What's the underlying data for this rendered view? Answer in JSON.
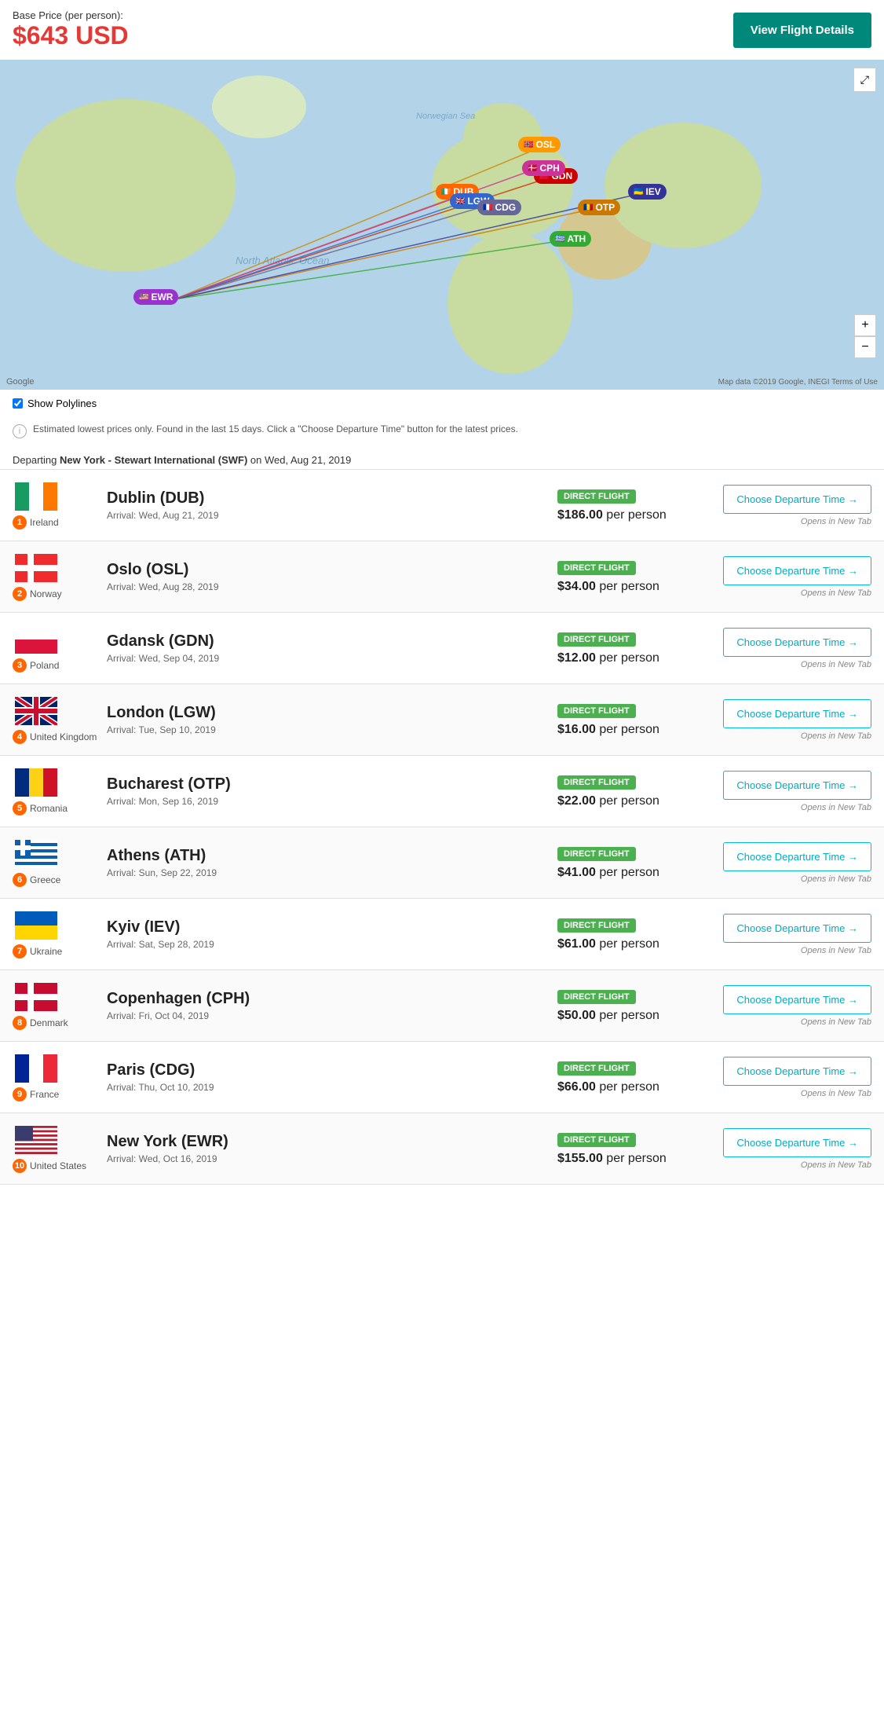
{
  "header": {
    "price_label": "Base Price (per person):",
    "price_value": "$643 USD",
    "view_details_label": "View Flight Details"
  },
  "map": {
    "expand_icon": "⤢",
    "zoom_in": "+",
    "zoom_out": "−",
    "google_label": "Google",
    "terms_label": "Map data ©2019 Google, INEGI  Terms of Use",
    "show_polylines_label": "Show Polylines"
  },
  "notice": {
    "text": "Estimated lowest prices only. Found in the last 15 days. Click a \"Choose Departure Time\" button for the latest prices."
  },
  "departing": {
    "label": "Departing New York - Stewart International (SWF) on Wed, Aug 21, 2019"
  },
  "flights": [
    {
      "num": 1,
      "country": "Ireland",
      "flag_colors": [
        "#169b62",
        "#fff",
        "#ff7900"
      ],
      "flag_type": "tricolor_vertical",
      "destination": "Dublin (DUB)",
      "arrival": "Arrival: Wed, Aug 21, 2019",
      "badge": "DIRECT FLIGHT",
      "price": "$186.00 per person",
      "price_amount": "$186.00",
      "btn_label": "Choose Departure Time →",
      "opens_label": "Opens in New Tab",
      "pin_code": "DUB",
      "pin_color": "#ff6600"
    },
    {
      "num": 2,
      "country": "Norway",
      "flag_colors": [
        "#ef2b2d",
        "#fff",
        "#002868"
      ],
      "flag_type": "cross",
      "destination": "Oslo (OSL)",
      "arrival": "Arrival: Wed, Aug 28, 2019",
      "badge": "DIRECT FLIGHT",
      "price": "$34.00 per person",
      "price_amount": "$34.00",
      "btn_label": "Choose Departure Time →",
      "opens_label": "Opens in New Tab",
      "pin_code": "OSL",
      "pin_color": "#ff9900"
    },
    {
      "num": 3,
      "country": "Poland",
      "flag_colors": [
        "#fff",
        "#dc143c"
      ],
      "flag_type": "bicolor_horizontal",
      "destination": "Gdansk (GDN)",
      "arrival": "Arrival: Wed, Sep 04, 2019",
      "badge": "DIRECT FLIGHT",
      "price": "$12.00 per person",
      "price_amount": "$12.00",
      "btn_label": "Choose Departure Time →",
      "opens_label": "Opens in New Tab",
      "pin_code": "GDN",
      "pin_color": "#cc0000"
    },
    {
      "num": 4,
      "country": "United Kingdom",
      "flag_colors": [
        "#012169",
        "#fff",
        "#c8102e"
      ],
      "flag_type": "union_jack",
      "destination": "London (LGW)",
      "arrival": "Arrival: Tue, Sep 10, 2019",
      "badge": "DIRECT FLIGHT",
      "price": "$16.00 per person",
      "price_amount": "$16.00",
      "btn_label": "Choose Departure Time →",
      "opens_label": "Opens in New Tab",
      "pin_code": "LGW",
      "pin_color": "#3366cc"
    },
    {
      "num": 5,
      "country": "Romania",
      "flag_colors": [
        "#002b7f",
        "#fcd116",
        "#ce1126"
      ],
      "flag_type": "tricolor_vertical",
      "destination": "Bucharest (OTP)",
      "arrival": "Arrival: Mon, Sep 16, 2019",
      "badge": "DIRECT FLIGHT",
      "price": "$22.00 per person",
      "price_amount": "$22.00",
      "btn_label": "Choose Departure Time →",
      "opens_label": "Opens in New Tab",
      "pin_code": "OTP",
      "pin_color": "#cc6600"
    },
    {
      "num": 6,
      "country": "Greece",
      "flag_colors": [
        "#0d5eaf",
        "#fff"
      ],
      "flag_type": "greek",
      "destination": "Athens (ATH)",
      "arrival": "Arrival: Sun, Sep 22, 2019",
      "badge": "DIRECT FLIGHT",
      "price": "$41.00 per person",
      "price_amount": "$41.00",
      "btn_label": "Choose Departure Time →",
      "opens_label": "Opens in New Tab",
      "pin_code": "ATH",
      "pin_color": "#33aa33"
    },
    {
      "num": 7,
      "country": "Ukraine",
      "flag_colors": [
        "#005bbb",
        "#ffd500"
      ],
      "flag_type": "bicolor_horizontal",
      "destination": "Kyiv (IEV)",
      "arrival": "Arrival: Sat, Sep 28, 2019",
      "badge": "DIRECT FLIGHT",
      "price": "$61.00 per person",
      "price_amount": "$61.00",
      "btn_label": "Choose Departure Time →",
      "opens_label": "Opens in New Tab",
      "pin_code": "IEV",
      "pin_color": "#333399"
    },
    {
      "num": 8,
      "country": "Denmark",
      "flag_colors": [
        "#c60c30",
        "#fff"
      ],
      "flag_type": "cross",
      "destination": "Copenhagen (CPH)",
      "arrival": "Arrival: Fri, Oct 04, 2019",
      "badge": "DIRECT FLIGHT",
      "price": "$50.00 per person",
      "price_amount": "$50.00",
      "btn_label": "Choose Departure Time →",
      "opens_label": "Opens in New Tab",
      "pin_code": "CPH",
      "pin_color": "#cc3399"
    },
    {
      "num": 9,
      "country": "France",
      "flag_colors": [
        "#002395",
        "#fff",
        "#ed2939"
      ],
      "flag_type": "tricolor_vertical",
      "destination": "Paris (CDG)",
      "arrival": "Arrival: Thu, Oct 10, 2019",
      "badge": "DIRECT FLIGHT",
      "price": "$66.00 per person",
      "price_amount": "$66.00",
      "btn_label": "Choose Departure Time →",
      "opens_label": "Opens in New Tab",
      "pin_code": "CDG",
      "pin_color": "#666699"
    },
    {
      "num": 10,
      "country": "United States",
      "flag_colors": [
        "#b22234",
        "#fff",
        "#3c3b6e"
      ],
      "flag_type": "us",
      "destination": "New York (EWR)",
      "arrival": "Arrival: Wed, Oct 16, 2019",
      "badge": "DIRECT FLIGHT",
      "price": "$155.00 per person",
      "price_amount": "$155.00",
      "btn_label": "Choose Departure Time →",
      "opens_label": "Opens in New Tab",
      "pin_code": "EWR",
      "pin_color": "#9933cc"
    }
  ]
}
